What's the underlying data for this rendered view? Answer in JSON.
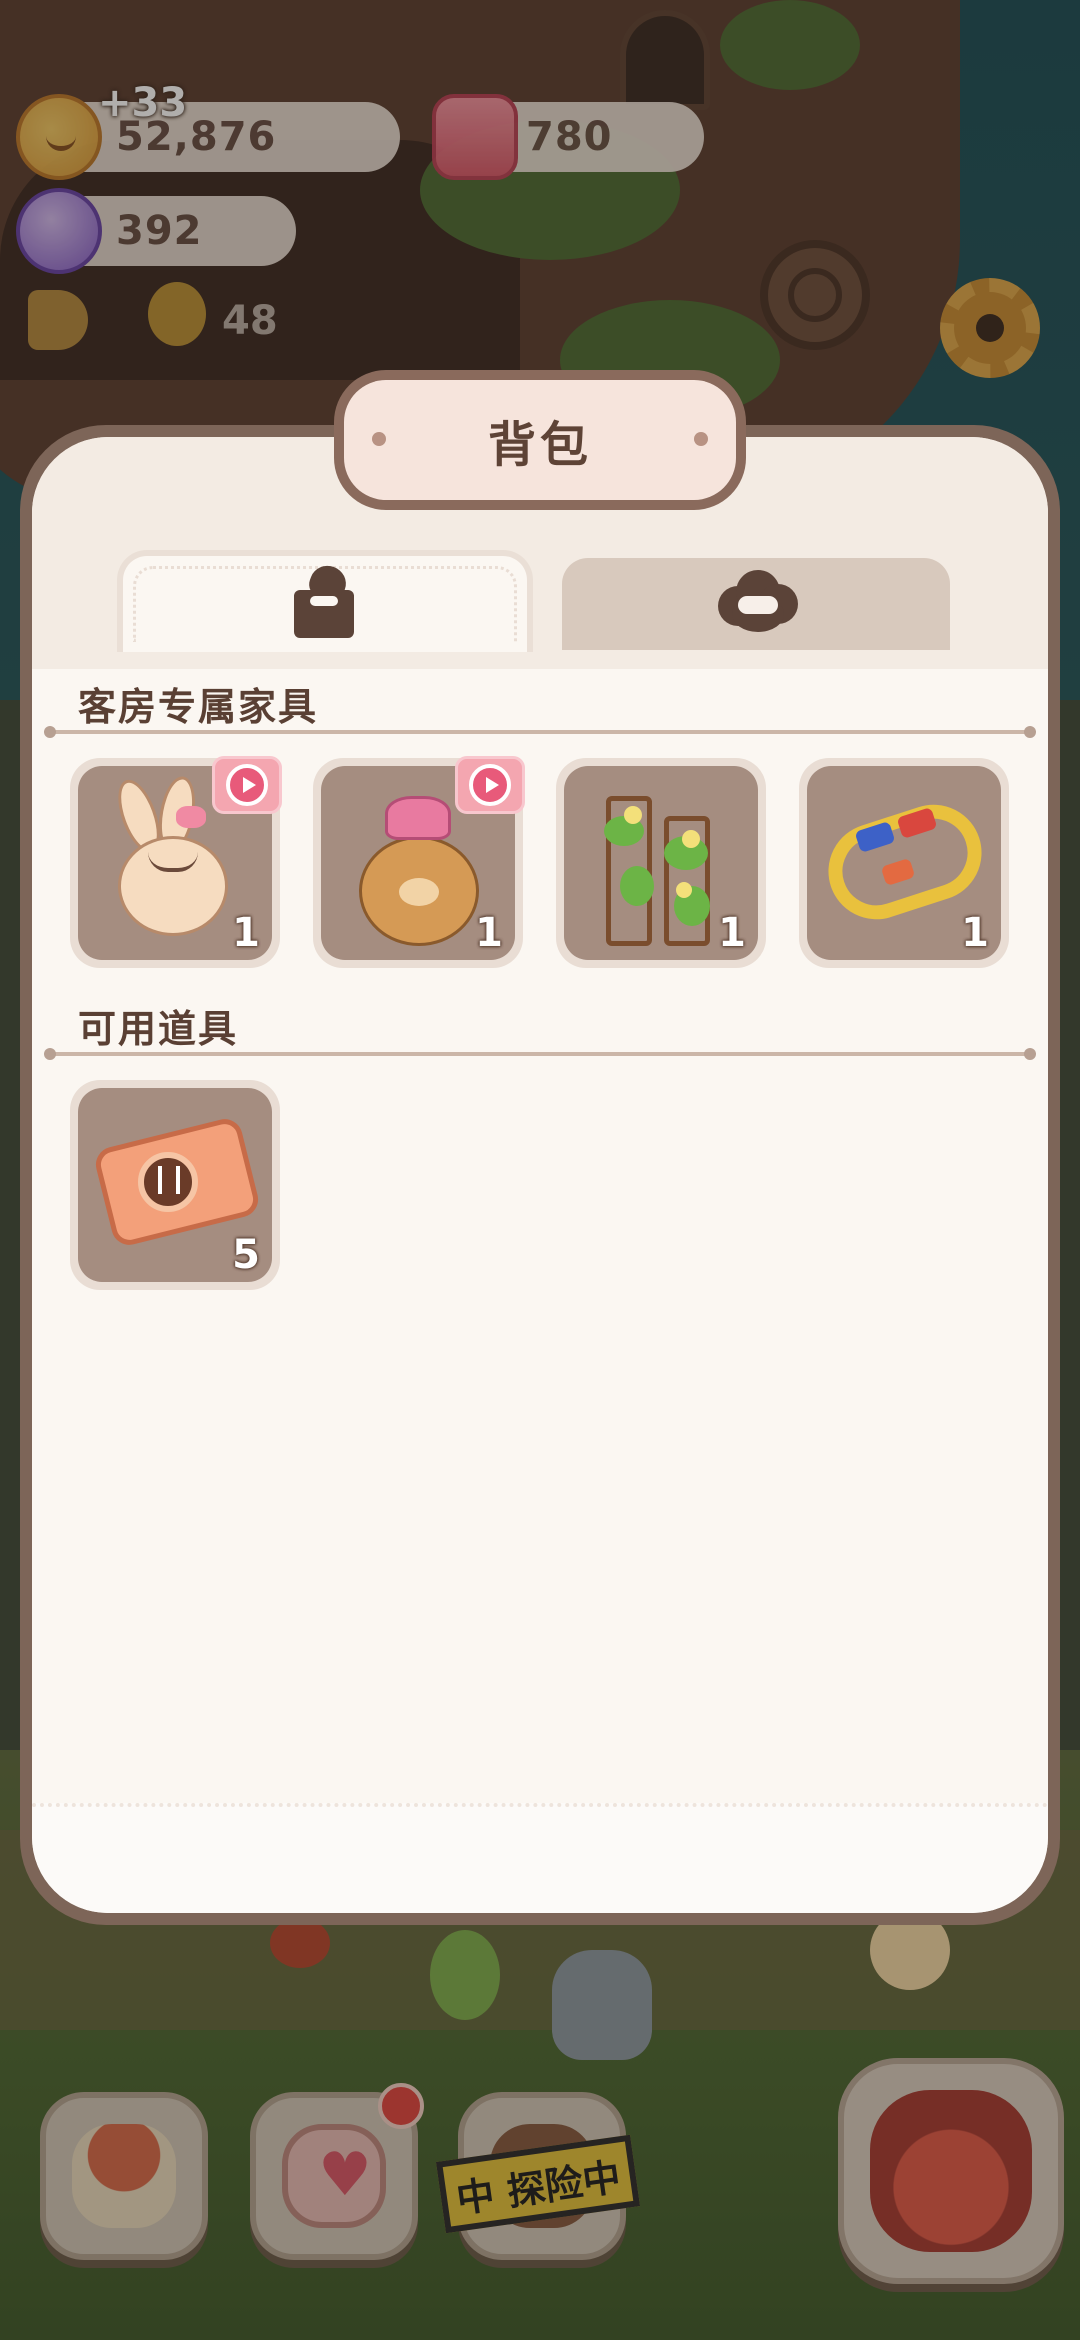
{
  "hud": {
    "coins": "52,876",
    "coins_float": "+33",
    "candles": "780",
    "gems": "392",
    "visitors": "48"
  },
  "panel": {
    "title": "背包",
    "tabs": [
      {
        "icon": "furniture-box-icon",
        "active": true
      },
      {
        "icon": "guest-cloud-icon",
        "active": false
      }
    ],
    "sections": [
      {
        "title": "客房专属家具",
        "items": [
          {
            "icon": "bunny-plush-icon",
            "count": "1",
            "video_badge": true
          },
          {
            "icon": "teddy-bear-icon",
            "count": "1",
            "video_badge": true
          },
          {
            "icon": "flower-vine-trellis-icon",
            "count": "1",
            "video_badge": false
          },
          {
            "icon": "toy-train-track-icon",
            "count": "1",
            "video_badge": false
          }
        ]
      },
      {
        "title": "可用道具",
        "items": [
          {
            "icon": "ticket-icon",
            "count": "5",
            "video_badge": false
          }
        ]
      }
    ]
  },
  "dock": {
    "explore_label": "中 探险中"
  },
  "colors": {
    "panel_border": "#7d6558",
    "panel_bg": "#fbf7f2",
    "slot_bg": "#a58d80",
    "badge_pink": "#f4a6b0",
    "accent_text": "#5a4034"
  }
}
